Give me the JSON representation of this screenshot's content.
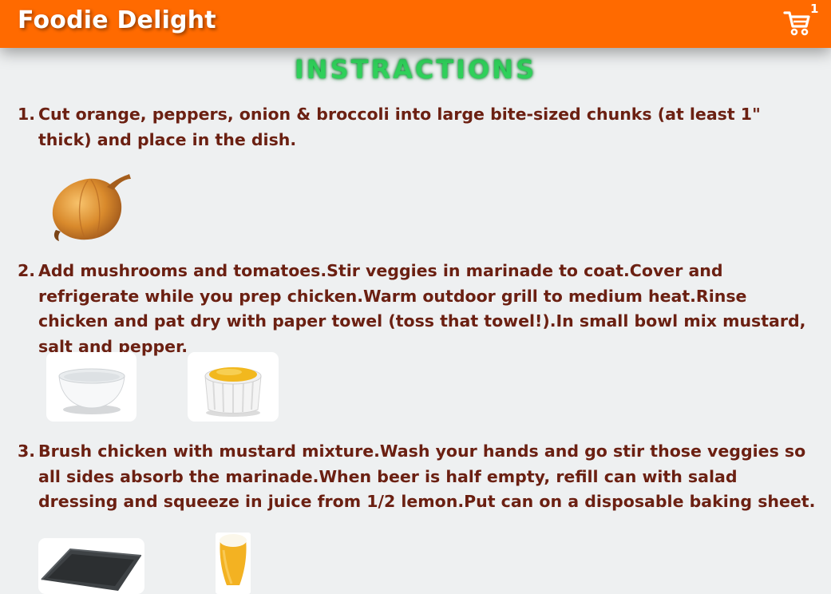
{
  "header": {
    "brand": "Foodie Delight",
    "cart_count": "1",
    "cart_icon": "cart-icon",
    "background_color": "#ff6a00"
  },
  "page": {
    "heading": "INSTRACTIONS",
    "heading_color": "#2fd05a"
  },
  "steps": [
    {
      "number": "1.",
      "text": "Cut orange, peppers, onion & broccoli into large bite-sized chunks (at least 1\" thick) and place in the dish.",
      "images": [
        "onion-image"
      ]
    },
    {
      "number": "2.",
      "text": "Add mushrooms and tomatoes.Stir veggies in marinade to coat.Cover and refrigerate while you prep chicken.Warm outdoor grill to medium heat.Rinse chicken and pat dry with paper towel (toss that towel!).In small bowl mix mustard, salt and pepper.",
      "images": [
        "bowl-image",
        "mustard-image"
      ]
    },
    {
      "number": "3.",
      "text": "Brush chicken with mustard mixture.Wash your hands and go stir those veggies so all sides absorb the marinade.When beer is half empty, refill can with salad dressing and squeeze in juice from 1/2 lemon.Put can on a disposable baking sheet.",
      "images": [
        "baking-sheet-image",
        "beer-image"
      ]
    }
  ]
}
